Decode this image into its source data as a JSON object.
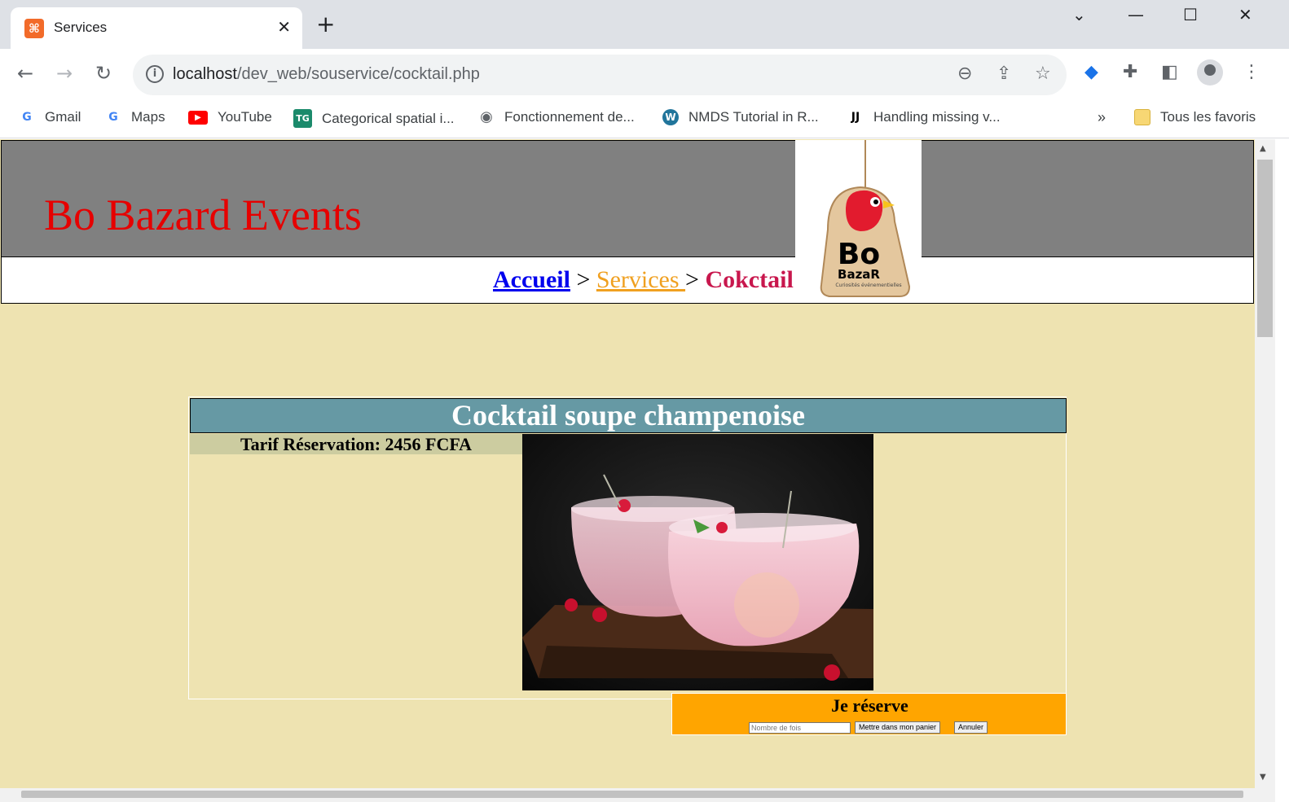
{
  "browser": {
    "tab_title": "Services",
    "url_host": "localhost",
    "url_path": "/dev_web/souservice/cocktail.php",
    "bookmarks": [
      {
        "label": "Gmail",
        "icon": "google-icon"
      },
      {
        "label": "Maps",
        "icon": "google-icon"
      },
      {
        "label": "YouTube",
        "icon": "youtube-icon"
      },
      {
        "label": "Categorical spatial i...",
        "icon": "tg-icon"
      },
      {
        "label": "Fonctionnement de...",
        "icon": "globe-icon"
      },
      {
        "label": "NMDS Tutorial in R...",
        "icon": "wordpress-icon"
      },
      {
        "label": "Handling missing v...",
        "icon": "jj-icon"
      }
    ],
    "all_bookmarks": "Tous les favoris",
    "overflow": "»"
  },
  "site": {
    "title": "Bo Bazard Events",
    "logo_main": "Bo",
    "logo_sub": "BazaR",
    "logo_tagline": "Curiosités événementielles"
  },
  "breadcrumb": {
    "home": "Accueil",
    "sep": ">",
    "services": "Services ",
    "current": "Cokctail"
  },
  "product": {
    "title": "Cocktail soupe champenoise",
    "price": "Tarif Réservation: 2456 FCFA"
  },
  "reserve": {
    "title": "Je réserve",
    "qty_placeholder": "Nombre de fois",
    "add_label": "Mettre dans mon panier",
    "cancel_label": "Annuler"
  },
  "colors": {
    "page_bg": "#eee3b1",
    "header_bg": "#808080",
    "title_red": "#e60000",
    "card_title_bg": "#6699a4",
    "reserve_bg": "#ffa500"
  }
}
